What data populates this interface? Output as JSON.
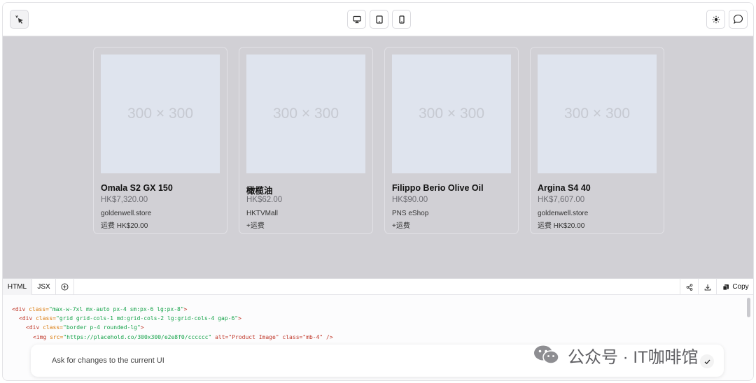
{
  "preview_modes": [
    {
      "name": "desktop",
      "icon": "monitor-icon"
    },
    {
      "name": "tablet",
      "icon": "tablet-icon"
    },
    {
      "name": "mobile",
      "icon": "phone-icon"
    }
  ],
  "products": [
    {
      "image_label": "300 × 300",
      "title": "Omala S2 GX 150",
      "price": "HK$7,320.00",
      "store": "goldenwell.store",
      "shipping": "运费 HK$20.00"
    },
    {
      "image_label": "300 × 300",
      "title": "橄榄油",
      "price": "HK$62.00",
      "store": "HKTVMall",
      "shipping": "+运费"
    },
    {
      "image_label": "300 × 300",
      "title": "Filippo Berio Olive Oil",
      "price": "HK$90.00",
      "store": "PNS eShop",
      "shipping": "+运费"
    },
    {
      "image_label": "300 × 300",
      "title": "Argina S4 40",
      "price": "HK$7,607.00",
      "store": "goldenwell.store",
      "shipping": "运费 HK$20.00"
    }
  ],
  "code_tabs": [
    {
      "label": "HTML",
      "active": true
    },
    {
      "label": "JSX",
      "active": false
    }
  ],
  "code_toolbar": {
    "copy_label": "Copy"
  },
  "code_lines": [
    {
      "open": "<div ",
      "attr": "class=",
      "val": "\"max-w-7xl mx-auto px-4 sm:px-6 lg:px-8\"",
      "close": ">"
    },
    {
      "open": "<div ",
      "attr": "class=",
      "val": "\"grid grid-cols-1 md:grid-cols-2 lg:grid-cols-4 gap-6\"",
      "close": ">"
    },
    {
      "open": "<div ",
      "attr": "class=",
      "val": "\"border p-4 rounded-lg\"",
      "close": ">"
    },
    {
      "open": "<img ",
      "attr": "src=",
      "val": "\"https://placehold.co/300x300/e2e8f0/cccccc\"",
      "close": " alt=\"Product Image\" class=\"mb-4\" />"
    }
  ],
  "chat": {
    "placeholder": "Ask for changes to the current UI"
  },
  "watermark": "公众号 · IT咖啡馆",
  "colors": {
    "preview_bg": "#d1d0d5",
    "placeholder_bg": "#dfe4ee",
    "placeholder_text": "#c6c9d1"
  }
}
